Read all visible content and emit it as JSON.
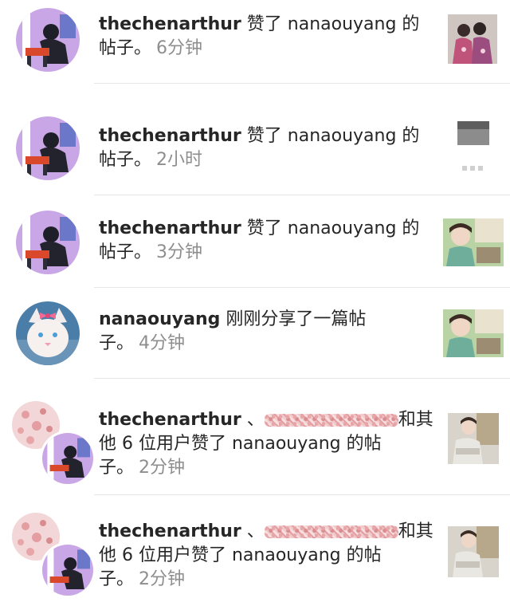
{
  "notifications": [
    {
      "user": "thechenarthur",
      "line1_suffix": " 赞了 nanaouyang 的",
      "line2": "帖子。",
      "time": "6分钟",
      "thumb": "photo-two-girls-pink"
    },
    {
      "user": "thechenarthur",
      "line1_suffix": " 赞了 nanaouyang 的",
      "line2": "帖子。",
      "time": "2小时",
      "thumb": "photo-gray-box"
    },
    {
      "user": "thechenarthur",
      "line1_suffix": " 赞了 nanaouyang 的",
      "line2": "帖子。",
      "time": "3分钟",
      "thumb": "photo-girl-car"
    },
    {
      "user": "nanaouyang",
      "line1_suffix": " 刚刚分享了一篇帖",
      "line2": "子。",
      "time": "4分钟",
      "thumb": "photo-girl-car"
    },
    {
      "user": "thechenarthur",
      "line1_suffix": " 、",
      "line1_end": "和其",
      "line2": "他 6 位用户赞了 nanaouyang 的帖",
      "line3": "子。",
      "time": "2分钟",
      "thumb": "photo-girl-sitting"
    },
    {
      "user": "thechenarthur",
      "line1_suffix": " 、",
      "line1_end": "和其",
      "line2": "他 6 位用户赞了 nanaouyang 的帖",
      "line3": "子。",
      "time": "2分钟",
      "thumb": "photo-girl-sitting"
    }
  ]
}
